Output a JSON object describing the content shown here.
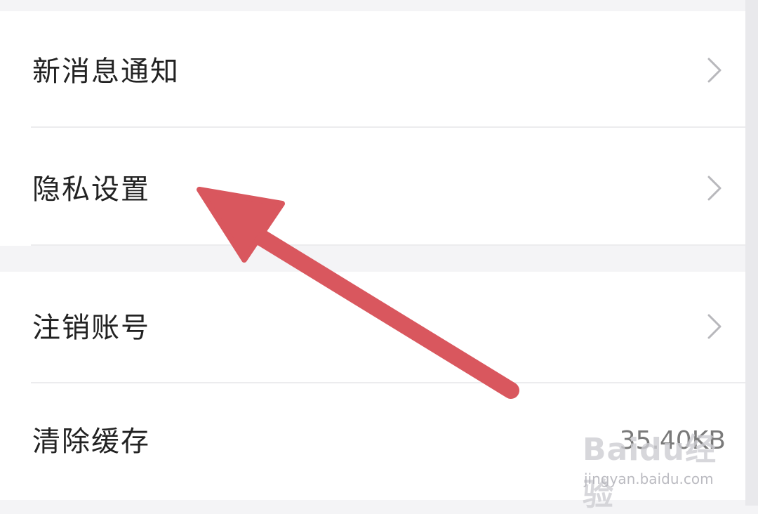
{
  "settings": {
    "items": [
      {
        "label": "新消息通知",
        "chevron": "chevron-right-icon"
      },
      {
        "label": "隐私设置",
        "chevron": "chevron-right-icon"
      },
      {
        "label": "注销账号",
        "chevron": "chevron-right-icon"
      },
      {
        "label": "清除缓存",
        "value": "35.40KB"
      }
    ]
  },
  "annotation": {
    "arrow_color": "#d9575e",
    "points_to": "隐私设置"
  },
  "watermark": {
    "logo_text": "Baidu经验",
    "url": "jingyan.baidu.com"
  },
  "colors": {
    "background": "#f4f4f6",
    "card": "#ffffff",
    "text": "#222222",
    "chevron": "#b8b8bc"
  }
}
